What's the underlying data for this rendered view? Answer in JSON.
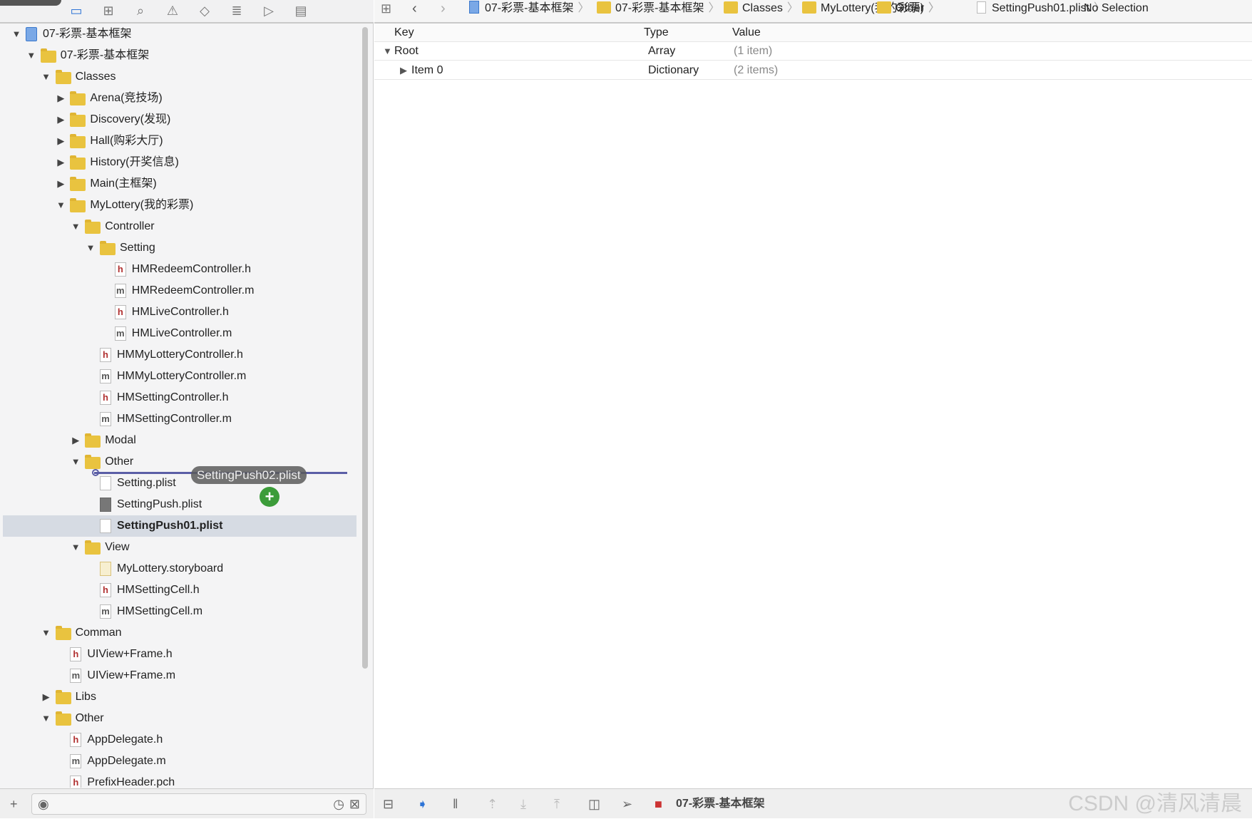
{
  "navigator": {
    "tabs": [
      {
        "icon": "folder-icon",
        "glyph": "▭",
        "active": true
      },
      {
        "icon": "hierarchy-icon",
        "glyph": "⊞"
      },
      {
        "icon": "search-icon",
        "glyph": "⌕"
      },
      {
        "icon": "warning-icon",
        "glyph": "⚠"
      },
      {
        "icon": "test-icon",
        "glyph": "◇"
      },
      {
        "icon": "debug-icon",
        "glyph": "≣"
      },
      {
        "icon": "breakpoint-icon",
        "glyph": "▷"
      },
      {
        "icon": "log-icon",
        "glyph": "▤"
      }
    ],
    "tree": [
      {
        "label": "07-彩票-基本框架",
        "level": 0,
        "type": "proj",
        "expanded": true
      },
      {
        "label": "07-彩票-基本框架",
        "level": 1,
        "type": "folder",
        "expanded": true
      },
      {
        "label": "Classes",
        "level": 2,
        "type": "folder",
        "expanded": true
      },
      {
        "label": "Arena(竞技场)",
        "level": 3,
        "type": "folder",
        "expanded": false
      },
      {
        "label": "Discovery(发现)",
        "level": 3,
        "type": "folder",
        "expanded": false
      },
      {
        "label": "Hall(购彩大厅)",
        "level": 3,
        "type": "folder",
        "expanded": false
      },
      {
        "label": "History(开奖信息)",
        "level": 3,
        "type": "folder",
        "expanded": false
      },
      {
        "label": "Main(主框架)",
        "level": 3,
        "type": "folder",
        "expanded": false
      },
      {
        "label": "MyLottery(我的彩票)",
        "level": 3,
        "type": "folder",
        "expanded": true
      },
      {
        "label": "Controller",
        "level": 4,
        "type": "folder",
        "expanded": true
      },
      {
        "label": "Setting",
        "level": 5,
        "type": "folder",
        "expanded": true
      },
      {
        "label": "HMRedeemController.h",
        "level": 6,
        "type": "h"
      },
      {
        "label": "HMRedeemController.m",
        "level": 6,
        "type": "m"
      },
      {
        "label": "HMLiveController.h",
        "level": 6,
        "type": "h"
      },
      {
        "label": "HMLiveController.m",
        "level": 6,
        "type": "m"
      },
      {
        "label": "HMMyLotteryController.h",
        "level": 5,
        "type": "h"
      },
      {
        "label": "HMMyLotteryController.m",
        "level": 5,
        "type": "m"
      },
      {
        "label": "HMSettingController.h",
        "level": 5,
        "type": "h"
      },
      {
        "label": "HMSettingController.m",
        "level": 5,
        "type": "m"
      },
      {
        "label": "Modal",
        "level": 4,
        "type": "folder",
        "expanded": false
      },
      {
        "label": "Other",
        "level": 4,
        "type": "folder",
        "expanded": true
      },
      {
        "label": "Setting.plist",
        "level": 5,
        "type": "plist"
      },
      {
        "label": "SettingPush.plist",
        "level": 5,
        "type": "plist-dark"
      },
      {
        "label": "SettingPush01.plist",
        "level": 5,
        "type": "plist",
        "selected": true
      },
      {
        "label": "View",
        "level": 4,
        "type": "folder",
        "expanded": true
      },
      {
        "label": "MyLottery.storyboard",
        "level": 5,
        "type": "sb"
      },
      {
        "label": "HMSettingCell.h",
        "level": 5,
        "type": "h"
      },
      {
        "label": "HMSettingCell.m",
        "level": 5,
        "type": "m"
      },
      {
        "label": "Comman",
        "level": 2,
        "type": "folder",
        "expanded": true
      },
      {
        "label": "UIView+Frame.h",
        "level": 3,
        "type": "h"
      },
      {
        "label": "UIView+Frame.m",
        "level": 3,
        "type": "m"
      },
      {
        "label": "Libs",
        "level": 2,
        "type": "folder",
        "expanded": false
      },
      {
        "label": "Other",
        "level": 2,
        "type": "folder",
        "expanded": true
      },
      {
        "label": "AppDelegate.h",
        "level": 3,
        "type": "h"
      },
      {
        "label": "AppDelegate.m",
        "level": 3,
        "type": "m"
      },
      {
        "label": "PrefixHeader.pch",
        "level": 3,
        "type": "h"
      }
    ],
    "drag_item": "SettingPush02.plist",
    "drag_badge": "+"
  },
  "jumpbar": {
    "crumbs": [
      {
        "label": "07-彩票-基本框架",
        "kind": "proj"
      },
      {
        "label": "07-彩票-基本框架",
        "kind": "folder"
      },
      {
        "label": "Classes",
        "kind": "folder"
      },
      {
        "label": "MyLottery(我的彩票)",
        "kind": "folder"
      },
      {
        "label": "Other",
        "kind": "folder"
      },
      {
        "label": "SettingPush01.plist",
        "kind": "file"
      },
      {
        "label": "No Selection",
        "kind": "none"
      }
    ]
  },
  "plist": {
    "headers": {
      "key": "Key",
      "type": "Type",
      "value": "Value"
    },
    "rows": [
      {
        "key": "Root",
        "type": "Array",
        "value": "(1 item)",
        "level": 0,
        "expanded": true
      },
      {
        "key": "Item 0",
        "type": "Dictionary",
        "value": "(2 items)",
        "level": 1,
        "expanded": false
      }
    ]
  },
  "debugbar": {
    "scheme": "07-彩票-基本框架",
    "watermark": "CSDN @清风清晨"
  }
}
